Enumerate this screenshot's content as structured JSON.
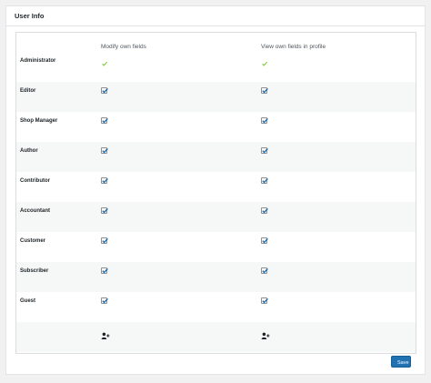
{
  "panel": {
    "title": "User Info"
  },
  "table": {
    "columns": [
      "",
      "Modify own fields",
      "View own fields in profile"
    ],
    "rows": [
      {
        "role": "Administrator",
        "modify": "tick",
        "view": "tick"
      },
      {
        "role": "Editor",
        "modify": "checked",
        "view": "checked"
      },
      {
        "role": "Shop Manager",
        "modify": "checked",
        "view": "checked"
      },
      {
        "role": "Author",
        "modify": "checked",
        "view": "checked"
      },
      {
        "role": "Contributor",
        "modify": "checked",
        "view": "checked"
      },
      {
        "role": "Accountant",
        "modify": "checked",
        "view": "checked"
      },
      {
        "role": "Customer",
        "modify": "checked",
        "view": "checked"
      },
      {
        "role": "Subscriber",
        "modify": "checked",
        "view": "checked"
      },
      {
        "role": "Guest",
        "modify": "checked",
        "view": "checked"
      }
    ],
    "footer_icons": [
      "add-user-icon",
      "add-user-icon"
    ]
  },
  "actions": {
    "save_label": "Save"
  },
  "colors": {
    "accent": "#2271b1",
    "tick": "#7ad03a",
    "check": "#2271b1"
  }
}
